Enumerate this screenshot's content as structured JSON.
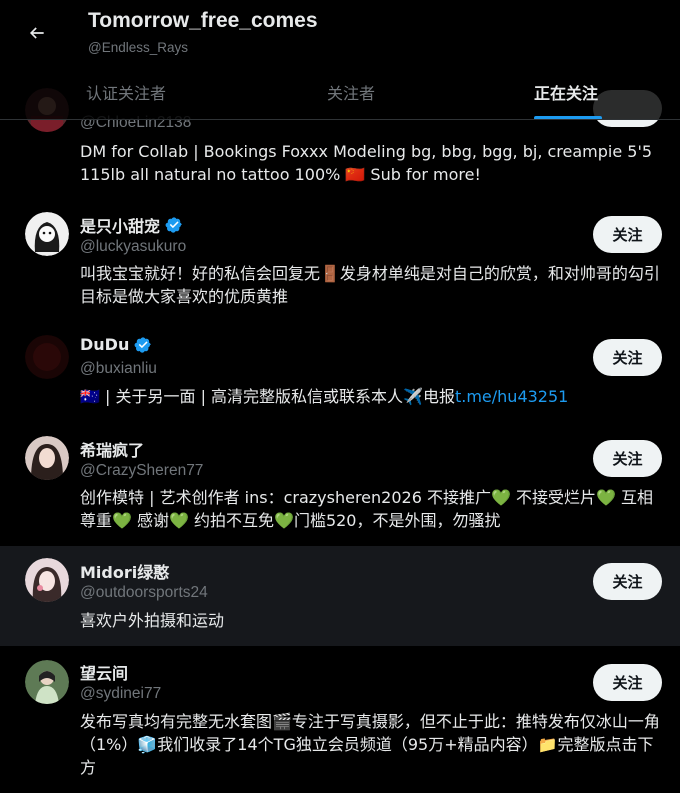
{
  "header": {
    "back_label": "←",
    "title": "Tomorrow_free_comes",
    "subtitle": "@Endless_Rays",
    "tabs": [
      {
        "label": "认证关注者",
        "active": false
      },
      {
        "label": "关注者",
        "active": false
      },
      {
        "label": "正在关注",
        "active": true
      }
    ]
  },
  "users": [
    {
      "name": "",
      "handle": "@ChloeLin2138",
      "verified": false,
      "bio": "DM for Collab | Bookings Foxxx Modeling bg, bbg, bgg, bj, creampie 5'5 115lb all natural no tattoo 100% 🇨🇳 Sub for more!",
      "follow_label": ""
    },
    {
      "name": "是只小甜宠",
      "handle": "@luckyasukuro",
      "verified": true,
      "bio": "叫我宝宝就好！好的私信会回复无🚪发身材单纯是对自己的欣赏，和对帅哥的勾引 目标是做大家喜欢的优质黄推",
      "follow_label": "关注"
    },
    {
      "name": "DuDu",
      "handle": "@buxianliu",
      "verified": true,
      "bio_prefix": "🇦🇺 | 关于另一面 | 高清完整版私信或联系本人✈️电报",
      "bio_link": "t.me/hu43251",
      "follow_label": "关注"
    },
    {
      "name": "希瑞疯了",
      "handle": "@CrazySheren77",
      "verified": false,
      "bio": "创作模特 | 艺术创作者 ins：crazysheren2026 不接推广💚 不接受烂片💚 互相尊重💚 感谢💚 约拍不互免💚门槛520，不是外围，勿骚扰",
      "follow_label": "关注"
    },
    {
      "name": "Midori绿憨",
      "handle": "@outdoorsports24",
      "verified": false,
      "bio": "喜欢户外拍摄和运动",
      "follow_label": "关注"
    },
    {
      "name": "望云间",
      "handle": "@sydinei77",
      "verified": false,
      "bio": "发布写真均有完整无水套图🎬专注于写真摄影，但不止于此：推特发布仅冰山一角（1%）🧊我们收录了14个TG独立会员频道（95万+精品内容）📁完整版点击下方",
      "follow_label": "关注"
    }
  ],
  "colors": {
    "background": "#000000",
    "row_hover": "#16181c",
    "text_primary": "#e7e9ea",
    "text_secondary": "#71767b",
    "accent": "#1d9bf0",
    "button_bg": "#eff3f4",
    "button_text": "#0f1419"
  }
}
